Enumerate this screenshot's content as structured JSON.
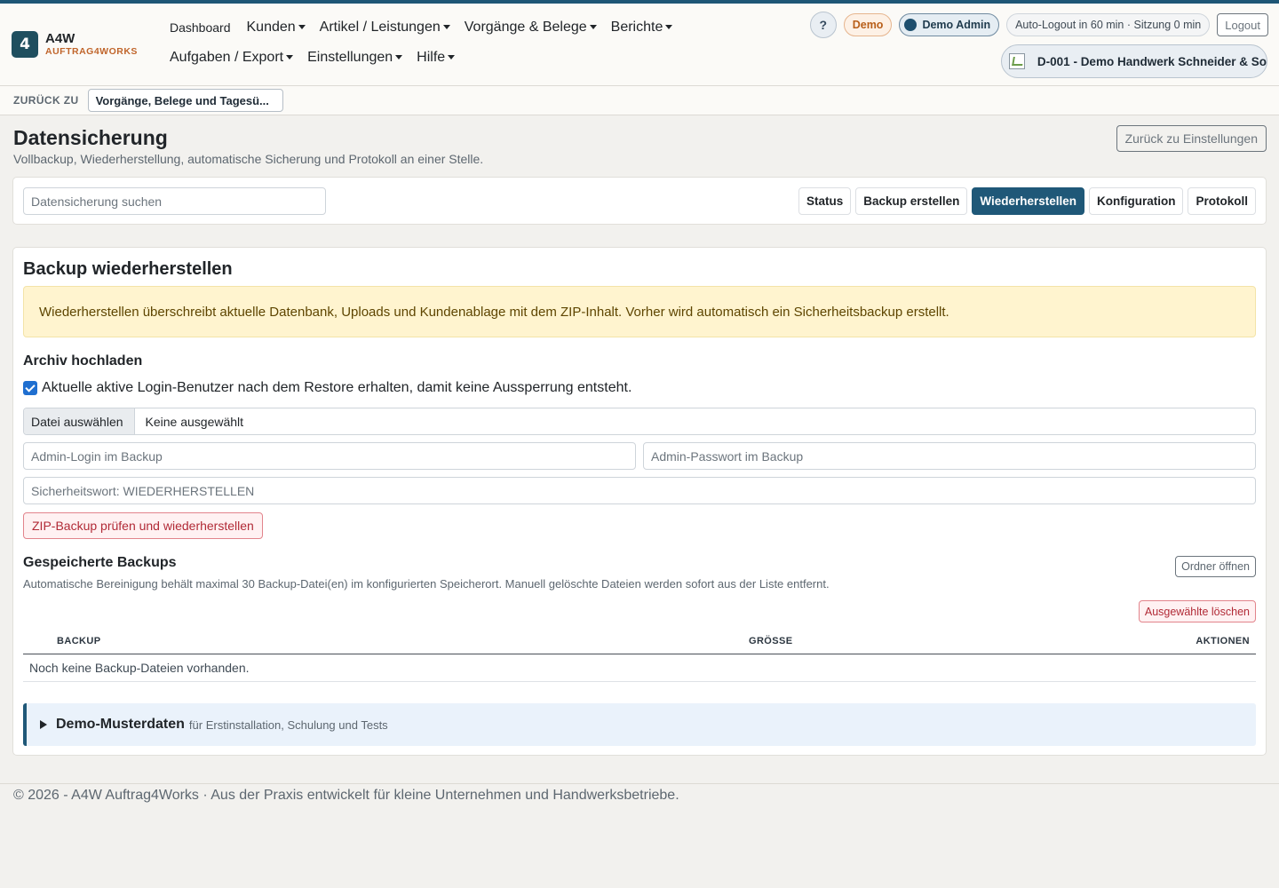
{
  "brand": {
    "badge": "4",
    "title": "A4W",
    "subtitle": "AUFTRAG4WORKS"
  },
  "nav": {
    "row1": [
      {
        "label": "Dashboard",
        "dropdown": false
      },
      {
        "label": "Kunden",
        "dropdown": true
      },
      {
        "label": "Artikel / Leistungen",
        "dropdown": true
      },
      {
        "label": "Vorgänge & Belege",
        "dropdown": true
      },
      {
        "label": "Berichte",
        "dropdown": true
      }
    ],
    "row2": [
      {
        "label": "Aufgaben / Export",
        "dropdown": true
      },
      {
        "label": "Einstellungen",
        "dropdown": true
      },
      {
        "label": "Hilfe",
        "dropdown": true
      }
    ]
  },
  "header": {
    "help": "?",
    "demo_badge": "Demo",
    "user": "Demo Admin",
    "session": "Auto-Logout in 60 min · Sitzung 0 min",
    "logout": "Logout",
    "tenant": "D-001 - Demo Handwerk Schneider & So"
  },
  "backbar": {
    "label": "ZURÜCK ZU",
    "value": "Vorgänge, Belege und Tagesü..."
  },
  "page": {
    "title": "Datensicherung",
    "subtitle": "Vollbackup, Wiederherstellung, automatische Sicherung und Protokoll an einer Stelle.",
    "back_button": "Zurück zu Einstellungen"
  },
  "toolbar": {
    "search_placeholder": "Datensicherung suchen",
    "tabs": [
      {
        "label": "Status",
        "active": false
      },
      {
        "label": "Backup erstellen",
        "active": false
      },
      {
        "label": "Wiederherstellen",
        "active": true
      },
      {
        "label": "Konfiguration",
        "active": false
      },
      {
        "label": "Protokoll",
        "active": false
      }
    ]
  },
  "restore": {
    "title": "Backup wiederherstellen",
    "warning": "Wiederherstellen überschreibt aktuelle Datenbank, Uploads und Kundenablage mit dem ZIP-Inhalt. Vorher wird automatisch ein Sicherheitsbackup erstellt.",
    "upload_heading": "Archiv hochladen",
    "keep_users_label": "Aktuelle aktive Login-Benutzer nach dem Restore erhalten, damit keine Aussperrung entsteht.",
    "keep_users_checked": true,
    "file_button": "Datei auswählen",
    "file_name": "Keine ausgewählt",
    "admin_login_placeholder": "Admin-Login im Backup",
    "admin_password_placeholder": "Admin-Passwort im Backup",
    "safety_word_placeholder": "Sicherheitswort: WIEDERHERSTELLEN",
    "submit": "ZIP-Backup prüfen und wiederherstellen"
  },
  "saved": {
    "title": "Gespeicherte Backups",
    "note": "Automatische Bereinigung behält maximal 30 Backup-Datei(en) im konfigurierten Speicherort. Manuell gelöschte Dateien werden sofort aus der Liste entfernt.",
    "open_folder": "Ordner öffnen",
    "delete_selected": "Ausgewählte löschen",
    "columns": {
      "backup": "BACKUP",
      "size": "GRÖSSE",
      "actions": "AKTIONEN"
    },
    "empty": "Noch keine Backup-Dateien vorhanden."
  },
  "demo_data": {
    "title": "Demo-Musterdaten",
    "subtitle": "für Erstinstallation, Schulung und Tests"
  },
  "footer": "© 2026 - A4W Auftrag4Works · Aus der Praxis entwickelt für kleine Unternehmen und Handwerksbetriebe.",
  "colors": {
    "primary": "#1f5878",
    "accent": "#c0652b",
    "danger": "#b12a36",
    "warning_bg": "#fff4cf"
  }
}
